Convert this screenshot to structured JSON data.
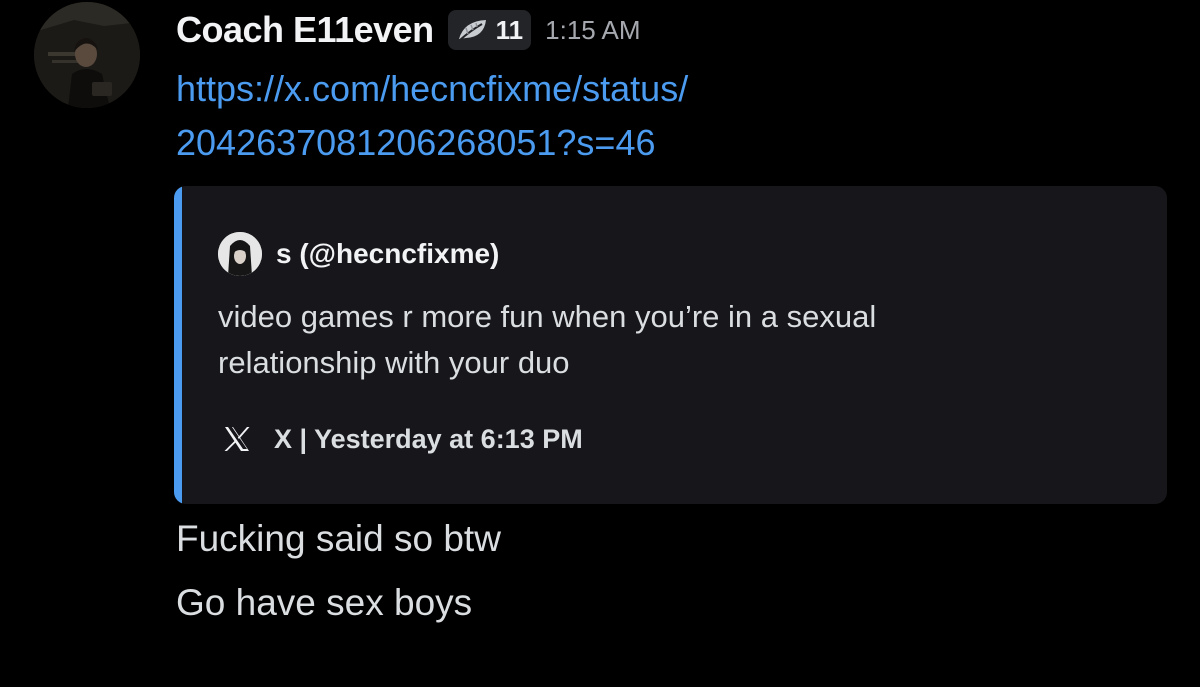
{
  "message": {
    "username": "Coach E11even",
    "server_tag": {
      "icon": "leaf-icon",
      "text": "11"
    },
    "timestamp": "1:15 AM",
    "link_lines": [
      "https://x.com/hecncfixme/status/",
      "2042637081206268051?s=46"
    ]
  },
  "embed": {
    "accent_color": "#4b9bf0",
    "author": "s (@hecncfixme)",
    "text_lines": [
      "video games r more fun when you’re in a sexual",
      "relationship with your duo"
    ],
    "footer_icon": "x-logo-icon",
    "footer": "X | Yesterday at 6:13 PM"
  },
  "follow_up_messages": [
    "Fucking said so btw",
    "Go have sex boys"
  ]
}
